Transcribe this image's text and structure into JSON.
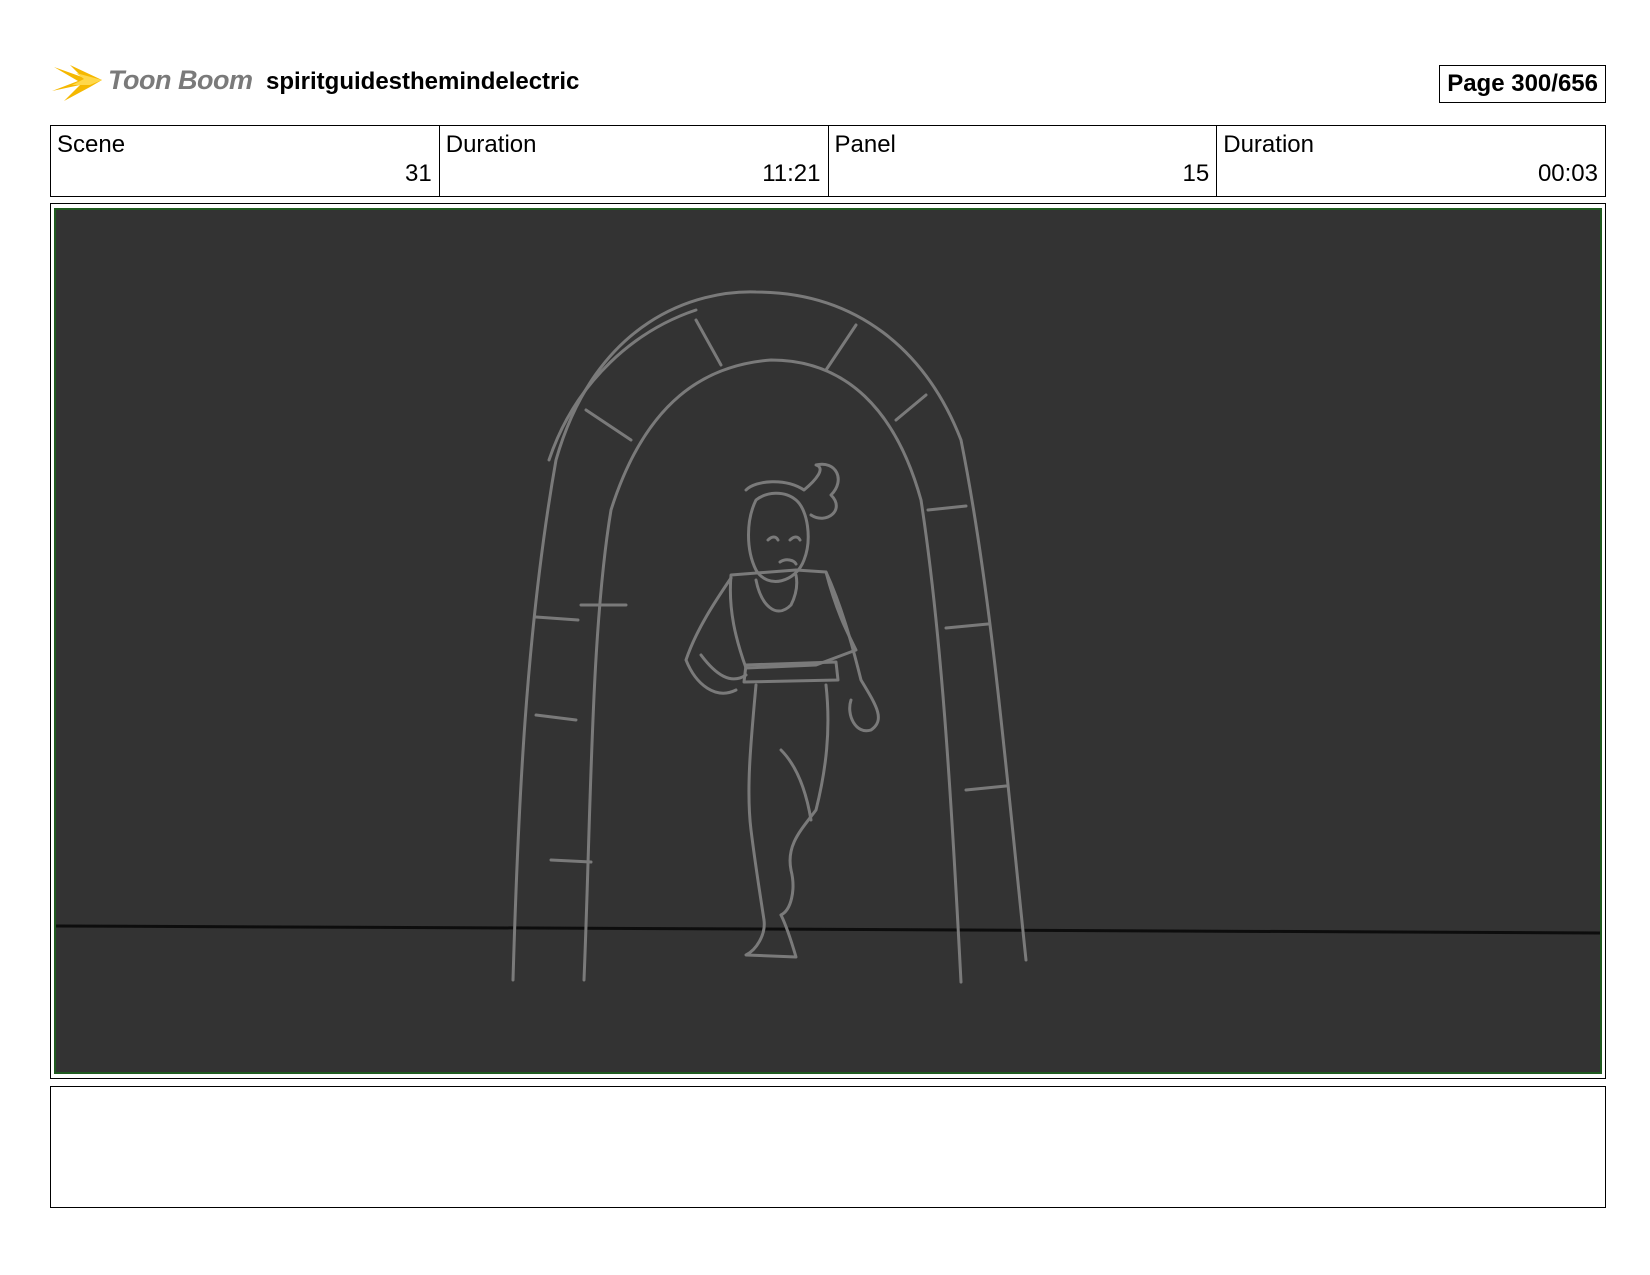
{
  "header": {
    "logo_icon": "toon-boom-star-icon",
    "logo_text": "Toon Boom",
    "title": "spiritguidesthemindelectric",
    "page": "Page 300/656"
  },
  "info": {
    "scene_label": "Scene",
    "scene_value": "31",
    "scene_duration_label": "Duration",
    "scene_duration_value": "11:21",
    "panel_label": "Panel",
    "panel_value": "15",
    "panel_duration_label": "Duration",
    "panel_duration_value": "00:03"
  },
  "panel": {
    "background_color": "#333333",
    "frame_color": "#1f5a1f",
    "sketch_color": "#7a7a7a"
  },
  "notes": {
    "text": ""
  }
}
